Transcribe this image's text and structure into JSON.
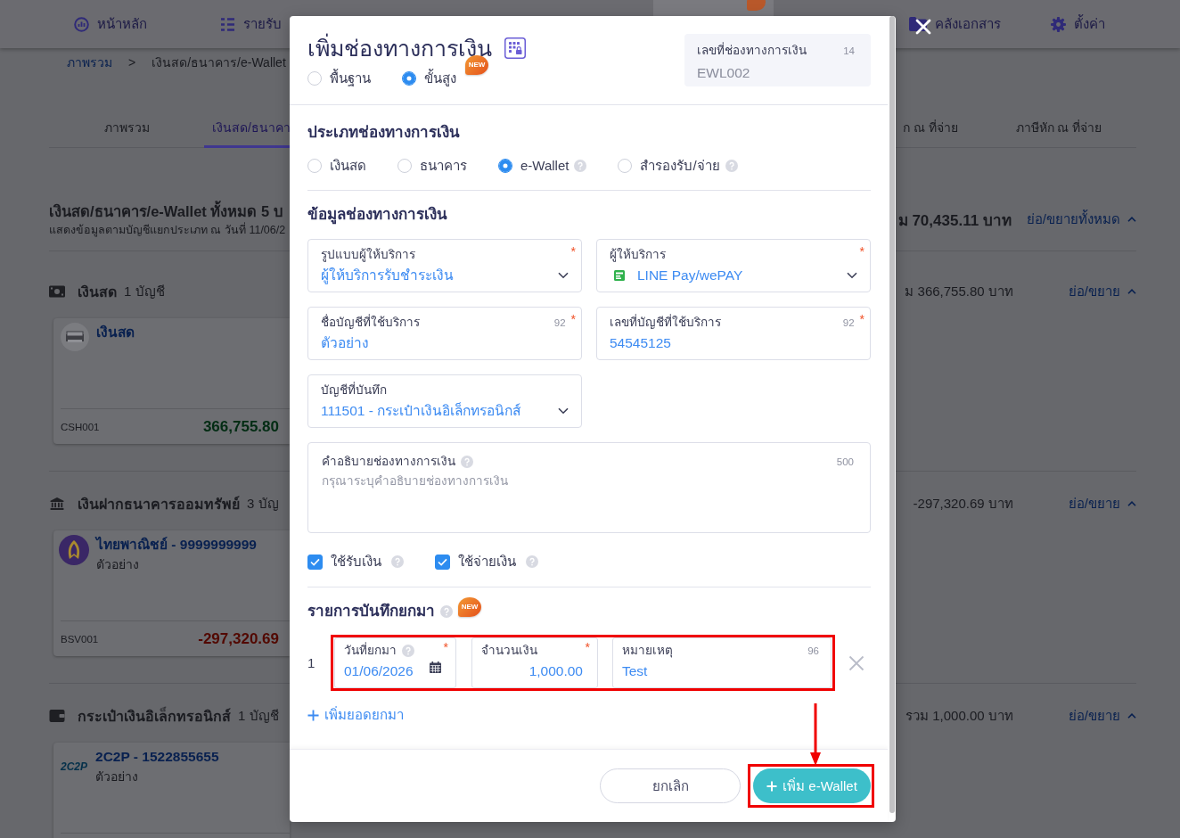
{
  "nav": {
    "left_items": [
      {
        "label": "หน้าหลัก",
        "kind": "dashboard",
        "selected": false
      },
      {
        "label": "รายรับ",
        "kind": "income",
        "selected": false
      }
    ],
    "covered_item": {
      "selected": true,
      "badge": true
    },
    "right_items": [
      {
        "label": "คลังเอกสาร",
        "kind": "documents",
        "selected": false
      },
      {
        "label": "ตั้งค่า",
        "kind": "settings",
        "selected": false
      }
    ]
  },
  "page": {
    "breadcrumb": {
      "items": [
        "ภาพรวม",
        "เงินสด/ธนาคาร/e-Wallet"
      ],
      "separator": ">"
    },
    "tabs_left": [
      {
        "label": "ภาพรวม",
        "selected": false
      },
      {
        "label": "เงินสด/ธนาคา",
        "selected": true
      }
    ],
    "tabs_right": [
      {
        "label": "ก ณ ที่จ่าย",
        "selected": false
      },
      {
        "label": "ภาษีหัก ณ ที่จ่าย",
        "selected": false
      }
    ],
    "summary": {
      "title": "เงินสด/ธนาคาร/e-Wallet ทั้งหมด 5 บ",
      "subtitle": "แสดงข้อมูลตามบัญชีแยกประเภท ณ วันที่ 11/06/2",
      "total": "ม 70,435.11 บาท",
      "toggle": "ย่อ/ขยายทั้งหมด",
      "expanded": true
    },
    "groups": [
      {
        "kind": "cash",
        "name": "เงินสด",
        "count": "1 บัญชี",
        "total": "ม 366,755.80 บาท",
        "toggle": "ย่อ/ขยาย",
        "expanded": true,
        "accounts": [
          {
            "kind": "cash",
            "name": "เงินสด",
            "code": "CSH001",
            "balance": "366,755.80",
            "negative": false
          }
        ]
      },
      {
        "kind": "bank",
        "name": "เงินฝากธนาคารออมทรัพย์",
        "count": "3 บัญ",
        "total": "-297,320.69 บาท",
        "toggle": "ย่อ/ขยาย",
        "expanded": true,
        "accounts": [
          {
            "kind": "bank",
            "name": "ไทยพาณิชย์ - 9999999999",
            "detail": "ตัวอย่าง",
            "code": "BSV001",
            "balance": "-297,320.69",
            "negative": true
          }
        ]
      },
      {
        "kind": "wallet",
        "name": "กระเป๋าเงินอิเล็กทรอนิกส์",
        "count": "1 บัญชี",
        "total": "รวม 1,000.00 บาท",
        "toggle": "ย่อ/ขยาย",
        "expanded": true,
        "accounts": [
          {
            "kind": "wallet",
            "logo_text": "2C2P",
            "name": "2C2P - 1522855655",
            "detail": "ตัวอย่าง"
          }
        ]
      }
    ]
  },
  "modal": {
    "title": "เพิ่มช่องทางการเงิน",
    "mode_options": [
      {
        "label": "พื้นฐาน",
        "selected": false
      },
      {
        "label": "ขั้นสูง",
        "selected": true,
        "badge": "NEW"
      }
    ],
    "code_field": {
      "label": "เลขที่ช่องทางการเงิน",
      "counter": "14",
      "value": "EWL002"
    },
    "type_section": {
      "title": "ประเภทช่องทางการเงิน",
      "options": [
        {
          "label": "เงินสด",
          "selected": false
        },
        {
          "label": "ธนาคาร",
          "selected": false
        },
        {
          "label": "e-Wallet",
          "selected": true,
          "help": true
        },
        {
          "label": "สำรองรับ/จ่าย",
          "selected": false,
          "help": true
        }
      ]
    },
    "info_section": {
      "title": "ข้อมูลช่องทางการเงิน",
      "fields": [
        {
          "kind": "select",
          "label": "รูปแบบผู้ให้บริการ",
          "mark": "*",
          "value": "ผู้ให้บริการรับชำระเงิน"
        },
        {
          "kind": "select",
          "label": "ผู้ให้บริการ",
          "mark": "*",
          "value": "LINE Pay/wePAY",
          "icon": true
        },
        {
          "kind": "text",
          "label": "ชื่อบัญชีที่ใช้บริการ",
          "counter": "92",
          "mark": "*",
          "value": "ตัวอย่าง"
        },
        {
          "kind": "text",
          "label": "เลขที่บัญชีที่ใช้บริการ",
          "counter": "92",
          "mark": "*",
          "value": "54545125"
        },
        {
          "kind": "select",
          "label": "บัญชีที่บันทึก",
          "value": "111501 - กระเป๋าเงินอิเล็กทรอนิกส์"
        }
      ],
      "description": {
        "label": "คำอธิบายช่องทางการเงิน",
        "help": true,
        "counter": "500",
        "placeholder": "กรุณาระบุคำอธิบายช่องทางการเงิน"
      },
      "checkboxes": [
        {
          "label": "ใช้รับเงิน",
          "checked": true,
          "help": true
        },
        {
          "label": "ใช้จ่ายเงิน",
          "checked": true,
          "help": true
        }
      ]
    },
    "opening_section": {
      "title": "รายการบันทึกยกมา",
      "help": true,
      "badge": "NEW",
      "rows": [
        {
          "number": "1",
          "annotated": true,
          "date": {
            "label": "วันที่ยกมา",
            "help": true,
            "mark": "*",
            "value": "01/06/2026"
          },
          "amount": {
            "label": "จำนวนเงิน",
            "mark": "*",
            "value": "1,000.00"
          },
          "note": {
            "label": "หมายเหตุ",
            "counter": "96",
            "value": "Test"
          }
        }
      ],
      "add_label": "เพิ่มยอดยกมา"
    },
    "buttons": [
      {
        "label": "ยกเลิก",
        "kind": "secondary"
      },
      {
        "label": "เพิ่ม e-Wallet",
        "kind": "primary",
        "annotated": true
      }
    ]
  }
}
